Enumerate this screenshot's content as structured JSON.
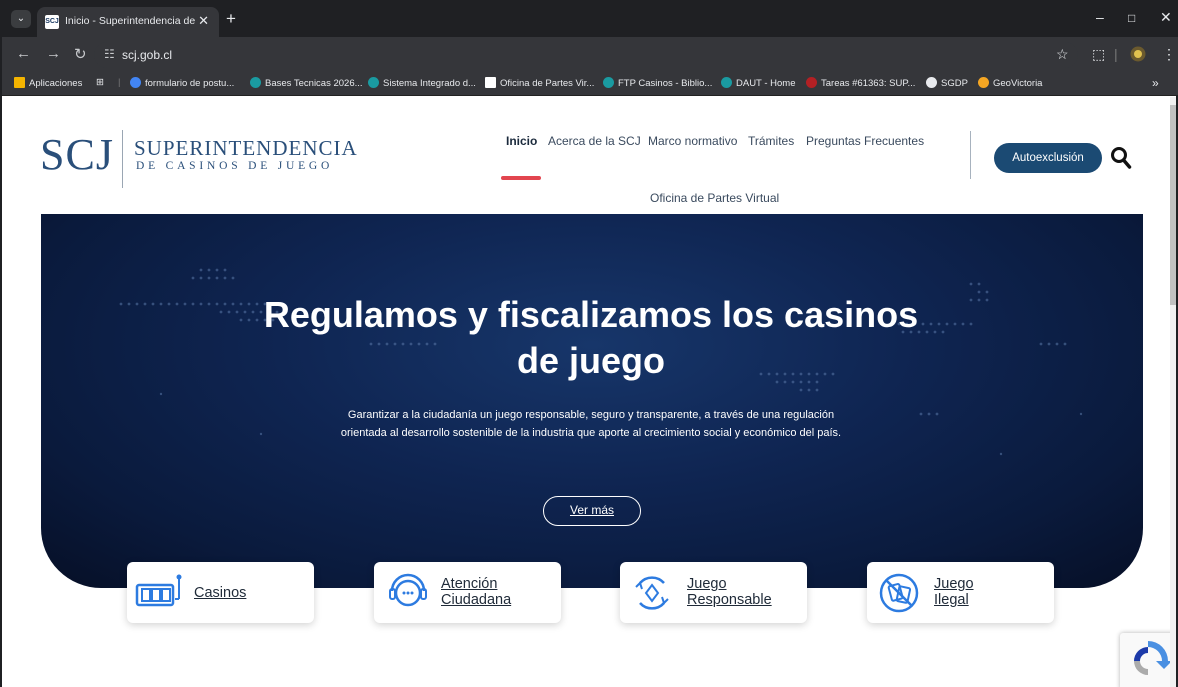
{
  "browser": {
    "tab_title": "Inicio - Superintendencia de Ca",
    "tab_favicon": "SCJ",
    "url": "scj.gob.cl",
    "bookmarks": [
      {
        "label": "Aplicaciones",
        "icon": "apps-grid-icon",
        "color": "#f4b400"
      },
      {
        "label": "formulario de postu...",
        "icon": "forms-icon",
        "color": "#4285f4"
      },
      {
        "label": "Bases Tecnicas 2026...",
        "icon": "sharepoint-icon",
        "color": "#1a9ba1"
      },
      {
        "label": "Sistema Integrado d...",
        "icon": "sharepoint-icon",
        "color": "#1a9ba1"
      },
      {
        "label": "Oficina de Partes Vir...",
        "icon": "scj-icon",
        "color": "#ffffff"
      },
      {
        "label": "FTP Casinos - Biblio...",
        "icon": "sharepoint-icon",
        "color": "#1a9ba1"
      },
      {
        "label": "DAUT - Home",
        "icon": "sharepoint-icon",
        "color": "#1a9ba1"
      },
      {
        "label": "Tareas #61363: SUP...",
        "icon": "redmine-icon",
        "color": "#b32024"
      },
      {
        "label": "SGDP",
        "icon": "globe-icon",
        "color": "#e8eaed"
      },
      {
        "label": "GeoVictoria",
        "icon": "location-pin-icon",
        "color": "#f5a623"
      }
    ]
  },
  "site": {
    "logo_mark": "SCJ",
    "logo_line1": "SUPERINTENDENCIA",
    "logo_line2": "DE CASINOS DE JUEGO",
    "nav": {
      "inicio": "Inicio",
      "acerca": "Acerca de la SCJ",
      "marco": "Marco normativo",
      "tramites": "Trámites",
      "preguntas": "Preguntas Frecuentes",
      "oficina": "Oficina de Partes Virtual"
    },
    "autoexclusion": "Autoexclusión",
    "accent_color": "#e2454f",
    "brand_color": "#1b4a73"
  },
  "hero": {
    "title": "Regulamos y fiscalizamos los casinos de juego",
    "subtitle": "Garantizar a la ciudadanía un juego responsable, seguro y transparente, a través de una regulación orientada al desarrollo sostenible de la industria que aporte al crecimiento social y económico del país.",
    "button": "Ver más"
  },
  "cards": [
    {
      "line1": "Casinos",
      "line2": "",
      "icon": "slot-machine-icon"
    },
    {
      "line1": "Atención",
      "line2": "Ciudadana",
      "icon": "support-headset-icon"
    },
    {
      "line1": "Juego",
      "line2": "Responsable",
      "icon": "responsible-gaming-icon"
    },
    {
      "line1": "Juego",
      "line2": "Ilegal",
      "icon": "illegal-gaming-icon"
    }
  ]
}
